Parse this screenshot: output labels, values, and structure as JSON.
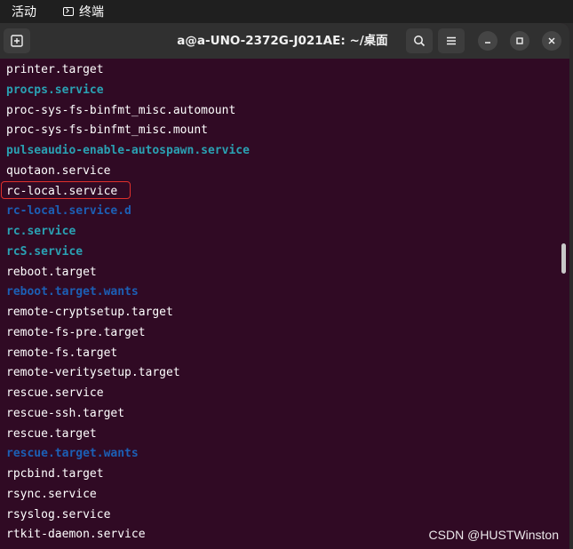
{
  "topbar": {
    "activities": "活动",
    "app_name": "终端"
  },
  "window": {
    "title": "a@a-UNO-2372G-J021AE: ~/桌面"
  },
  "colors": {
    "background": "#300a24",
    "plain": "#ffffff",
    "cyan": "#2aa1b3",
    "blue": "#1c5fb5",
    "highlight": "#e0302c"
  },
  "terminal": {
    "lines": [
      {
        "text": "printer.target",
        "style": "plain"
      },
      {
        "text": "procps.service",
        "style": "cyan"
      },
      {
        "text": "proc-sys-fs-binfmt_misc.automount",
        "style": "plain"
      },
      {
        "text": "proc-sys-fs-binfmt_misc.mount",
        "style": "plain"
      },
      {
        "text": "pulseaudio-enable-autospawn.service",
        "style": "cyan"
      },
      {
        "text": "quotaon.service",
        "style": "plain"
      },
      {
        "text": "rc-local.service",
        "style": "plain",
        "highlighted": true
      },
      {
        "text": "rc-local.service.d",
        "style": "blue"
      },
      {
        "text": "rc.service",
        "style": "cyan"
      },
      {
        "text": "rcS.service",
        "style": "cyan"
      },
      {
        "text": "reboot.target",
        "style": "plain"
      },
      {
        "text": "reboot.target.wants",
        "style": "blue"
      },
      {
        "text": "remote-cryptsetup.target",
        "style": "plain"
      },
      {
        "text": "remote-fs-pre.target",
        "style": "plain"
      },
      {
        "text": "remote-fs.target",
        "style": "plain"
      },
      {
        "text": "remote-veritysetup.target",
        "style": "plain"
      },
      {
        "text": "rescue.service",
        "style": "plain"
      },
      {
        "text": "rescue-ssh.target",
        "style": "plain"
      },
      {
        "text": "rescue.target",
        "style": "plain"
      },
      {
        "text": "rescue.target.wants",
        "style": "blue"
      },
      {
        "text": "rpcbind.target",
        "style": "plain"
      },
      {
        "text": "rsync.service",
        "style": "plain"
      },
      {
        "text": "rsyslog.service",
        "style": "plain"
      },
      {
        "text": "rtkit-daemon.service",
        "style": "plain"
      }
    ]
  },
  "watermark": "CSDN @HUSTWinston"
}
